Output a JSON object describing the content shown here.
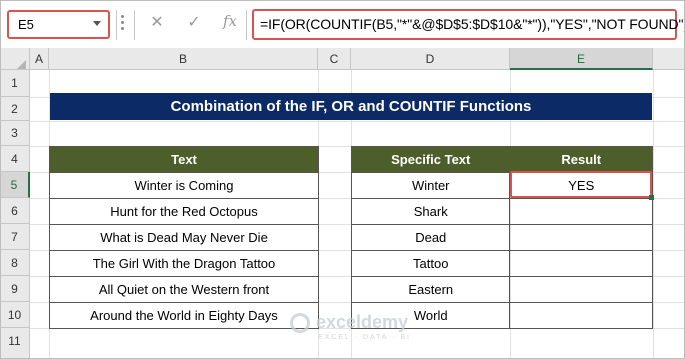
{
  "formula_bar": {
    "name_box": "E5",
    "cancel_icon": "✕",
    "enter_icon": "✓",
    "fx_label": "fx",
    "formula": "=IF(OR(COUNTIF(B5,\"*\"&@$D$5:$D$10&\"*\")),\"YES\",\"NOT FOUND\")"
  },
  "columns": [
    "A",
    "B",
    "C",
    "D",
    "E"
  ],
  "selected_column": "E",
  "rows": [
    "1",
    "2",
    "3",
    "4",
    "5",
    "6",
    "7",
    "8",
    "9",
    "10",
    "11"
  ],
  "selected_row": "5",
  "title": "Combination of the  IF, OR and COUNTIF Functions",
  "text_table": {
    "header": "Text",
    "cells": [
      "Winter is Coming",
      "Hunt for the Red Octopus",
      "What is Dead May Never Die",
      "The Girl With the Dragon Tattoo",
      "All Quiet on the Western front",
      "Around the World in Eighty Days"
    ]
  },
  "result_table": {
    "headers": [
      "Specific Text",
      "Result"
    ],
    "specific": [
      "Winter",
      "Shark",
      "Dead",
      "Tattoo",
      "Eastern",
      "World"
    ],
    "results": [
      "YES",
      "",
      "",
      "",
      "",
      ""
    ]
  },
  "watermark": {
    "name": "exceldemy",
    "tagline": "EXCEL · DATA · BI"
  },
  "colors": {
    "title_bg": "#0b2a66",
    "header_bg": "#4e5e2a",
    "highlight": "#d9534f",
    "excel_green": "#217346"
  }
}
